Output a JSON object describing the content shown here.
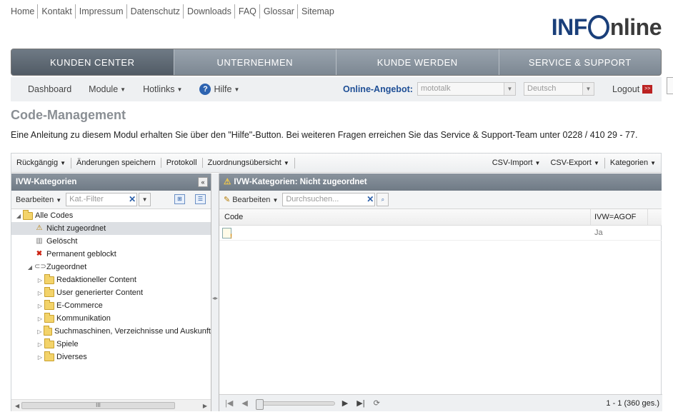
{
  "top_links": [
    "Home",
    "Kontakt",
    "Impressum",
    "Datenschutz",
    "Downloads",
    "FAQ",
    "Glossar",
    "Sitemap"
  ],
  "logo": {
    "part1": "INF",
    "part2": "nline"
  },
  "main_nav": [
    "KUNDEN CENTER",
    "UNTERNEHMEN",
    "KUNDE WERDEN",
    "SERVICE & SUPPORT"
  ],
  "sub_nav": {
    "dashboard": "Dashboard",
    "module": "Module",
    "hotlinks": "Hotlinks",
    "hilfe": "Hilfe",
    "online_label": "Online-Angebot:",
    "online_value": "mototalk",
    "language": "Deutsch",
    "logout": "Logout"
  },
  "page": {
    "title": "Code-Management",
    "intro": "Eine Anleitung zu diesem Modul erhalten Sie über den \"Hilfe\"-Button. Bei weiteren Fragen erreichen Sie das Service & Support-Team unter 0228 / 410 29 - 77."
  },
  "toolbar": {
    "undo": "Rückgängig",
    "save": "Änderungen speichern",
    "log": "Protokoll",
    "overview": "Zuordnungsübersicht",
    "csv_import": "CSV-Import",
    "csv_export": "CSV-Export",
    "categories": "Kategorien"
  },
  "left_panel": {
    "title": "IVW-Kategorien",
    "edit": "Bearbeiten",
    "filter_placeholder": "Kat.-Filter",
    "tree": [
      {
        "label": "Alle Codes"
      },
      {
        "label": "Nicht zugeordnet"
      },
      {
        "label": "Gelöscht"
      },
      {
        "label": "Permanent geblockt"
      },
      {
        "label": "Zugeordnet"
      },
      {
        "label": "Redaktioneller Content"
      },
      {
        "label": "User generierter Content"
      },
      {
        "label": "E-Commerce"
      },
      {
        "label": "Kommunikation"
      },
      {
        "label": "Suchmaschinen, Verzeichnisse und Auskunft"
      },
      {
        "label": "Spiele"
      },
      {
        "label": "Diverses"
      }
    ]
  },
  "right_panel": {
    "title": "IVW-Kategorien: Nicht zugeordnet",
    "edit": "Bearbeiten",
    "search_placeholder": "Durchsuchen...",
    "columns": [
      "Code",
      "IVW=AGOF"
    ],
    "rows": [
      {
        "code": "",
        "ivw": "Ja"
      }
    ],
    "pager_info": "1 - 1 (360 ges.)"
  }
}
